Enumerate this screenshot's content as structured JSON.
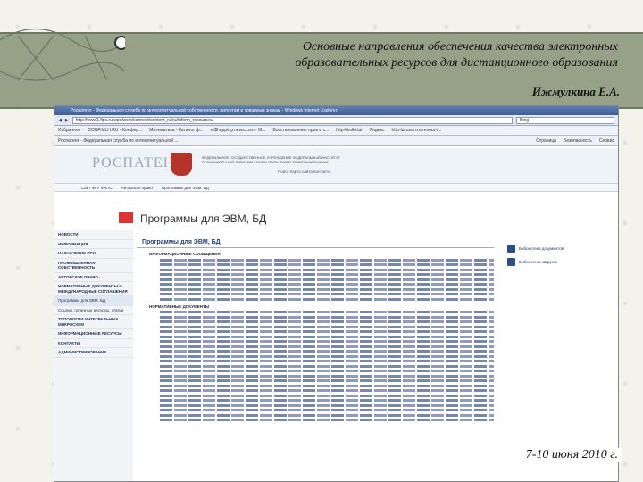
{
  "slide": {
    "title": "Основные направления обеспечения качества электронных образовательных ресурсов для дистанционного образования",
    "author": "Ижмулкина Е.А.",
    "date": "7-10 июня  2010 г."
  },
  "browser": {
    "window_title": "Роспатент - Федеральная служба по интеллектуальной собственности, патентам и товарным знакам - Windows Internet Explorer",
    "url": "http://www1.fips.ru/wps/wcm/connect/content_ru/ru/inform_resources/",
    "search_engine": "Bing",
    "favorites_label": "Избранное",
    "favorites": [
      "CONF.MLH.RU - Конфер...",
      "Математика - Каталог ф...",
      "re$hopping news.com - M...",
      "Восстановление пров и с...",
      "http-kimiki.tut",
      "Яндекс",
      "http-itz.uson.ru-resour-i..."
    ],
    "tab_label": "Роспатент - Федеральная служба по интеллектуальной ...",
    "tab_tools": [
      "Страница",
      "Безопасность",
      "Сервис"
    ]
  },
  "site": {
    "logo": "РОСПАТЕНТ",
    "org_name": "ФЕДЕРАЛЬНОЕ ГОСУДАРСТВЕННОЕ УЧРЕЖДЕНИЕ ФЕДЕРАЛЬНЫЙ ИНСТИТУТ ПРОМЫШЛЕННОЙ СОБСТВЕННОСТИ ПАТЕНТАМ И ТОВАРНЫМ ЗНАКАМ",
    "top_links": "Поиск   Карта сайта   Контакты",
    "nav": [
      "Сайт ФГУ ФИПС",
      "Авторское право",
      "Программы для ЭВМ, БД"
    ],
    "page_title": "Программы для ЭВМ, БД",
    "sidebar": [
      "НОВОСТИ",
      "ИНФОРМАЦИЯ",
      "НАЗНАЧЕНИЕ ИРИ",
      "ПРОМЫШЛЕННАЯ СОБСТВЕННОСТЬ",
      "АВТОРСКОЕ ПРАВО",
      "НОРМАТИВНЫЕ ДОКУМЕНТЫ И МЕЖДУНАРОДНЫЕ СОГЛАШЕНИЯ",
      "Программы для ЭВМ, БД",
      "Ссылки, полезные ресурсы, статьи",
      "ТОПОЛОГИИ ИНТЕГРАЛЬНЫХ МИКРОСХЕМ",
      "ИНФОРМАЦИОННЫЕ РЕСУРСЫ",
      "КОНТАКТЫ",
      "АДМИНИСТРИРОВАНИЕ"
    ],
    "main_title": "Программы для ЭВМ, БД",
    "section_1": "ИНФОРМАЦИОННЫЕ СООБЩЕНИЯ",
    "section_2": "НОРМАТИВНЫЕ ДОКУМЕНТЫ",
    "right_links": [
      "Библиотека документов",
      "Библиотека загрузок"
    ]
  }
}
